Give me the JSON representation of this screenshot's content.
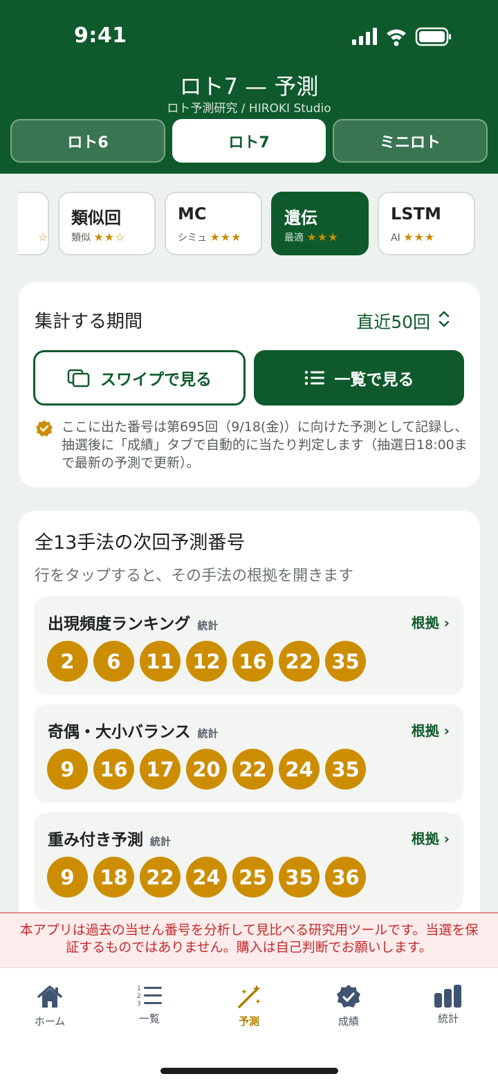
{
  "status": {
    "time": "9:41"
  },
  "header": {
    "title": "ロト7 — 予測",
    "subtitle": "ロト予測研究 / HIROKI Studio",
    "segments": [
      {
        "label": "ロト6",
        "active": false
      },
      {
        "label": "ロト7",
        "active": true
      },
      {
        "label": "ミニロト",
        "active": false
      }
    ]
  },
  "methods": [
    {
      "name": "",
      "sub": "",
      "stars": "☆",
      "active": false
    },
    {
      "name": "類似回",
      "sub": "類似",
      "stars": "★★☆",
      "active": false
    },
    {
      "name": "MC",
      "sub": "シミュ",
      "stars": "★★★",
      "active": false
    },
    {
      "name": "遺伝",
      "sub": "最適",
      "stars": "★★★",
      "active": true
    },
    {
      "name": "LSTM",
      "sub": "AI",
      "stars": "★★★",
      "active": false
    }
  ],
  "period": {
    "label": "集計する期間",
    "value": "直近50回",
    "swipe_button": "スワイプで見る",
    "list_button": "一覧で見る",
    "note": "ここに出た番号は第695回（9/18(金)）に向けた予測として記録し、抽選後に「成績」タブで自動的に当たり判定します（抽選日18:00まで最新の予測で更新）。"
  },
  "predictions": {
    "title": "全13手法の次回予測番号",
    "subtitle": "行をタップすると、その手法の根拠を開きます",
    "link_label": "根拠 ›",
    "rows": [
      {
        "name": "出現頻度ランキング",
        "tag": "統計",
        "numbers": [
          "2",
          "6",
          "11",
          "12",
          "16",
          "22",
          "35"
        ]
      },
      {
        "name": "奇偶・大小バランス",
        "tag": "統計",
        "numbers": [
          "9",
          "16",
          "17",
          "20",
          "22",
          "24",
          "35"
        ]
      },
      {
        "name": "重み付き予測",
        "tag": "統計",
        "numbers": [
          "9",
          "18",
          "22",
          "24",
          "25",
          "35",
          "36"
        ]
      }
    ]
  },
  "disclaimer": "本アプリは過去の当せん番号を分析して見比べる研究用ツールです。当選を保証するものではありません。購入は自己判断でお願いします。",
  "tabs": [
    {
      "label": "ホーム",
      "icon": "home-icon",
      "active": false
    },
    {
      "label": "一覧",
      "icon": "list-numbered-icon",
      "active": false
    },
    {
      "label": "予測",
      "icon": "magic-wand-icon",
      "active": true
    },
    {
      "label": "成績",
      "icon": "verified-badge-icon",
      "active": false
    },
    {
      "label": "統計",
      "icon": "bar-chart-icon",
      "active": false
    }
  ],
  "colors": {
    "primary": "#0f5a2c",
    "ball": "#cc8e00",
    "accent_gold": "#b07e00",
    "warning": "#c42a2a"
  }
}
